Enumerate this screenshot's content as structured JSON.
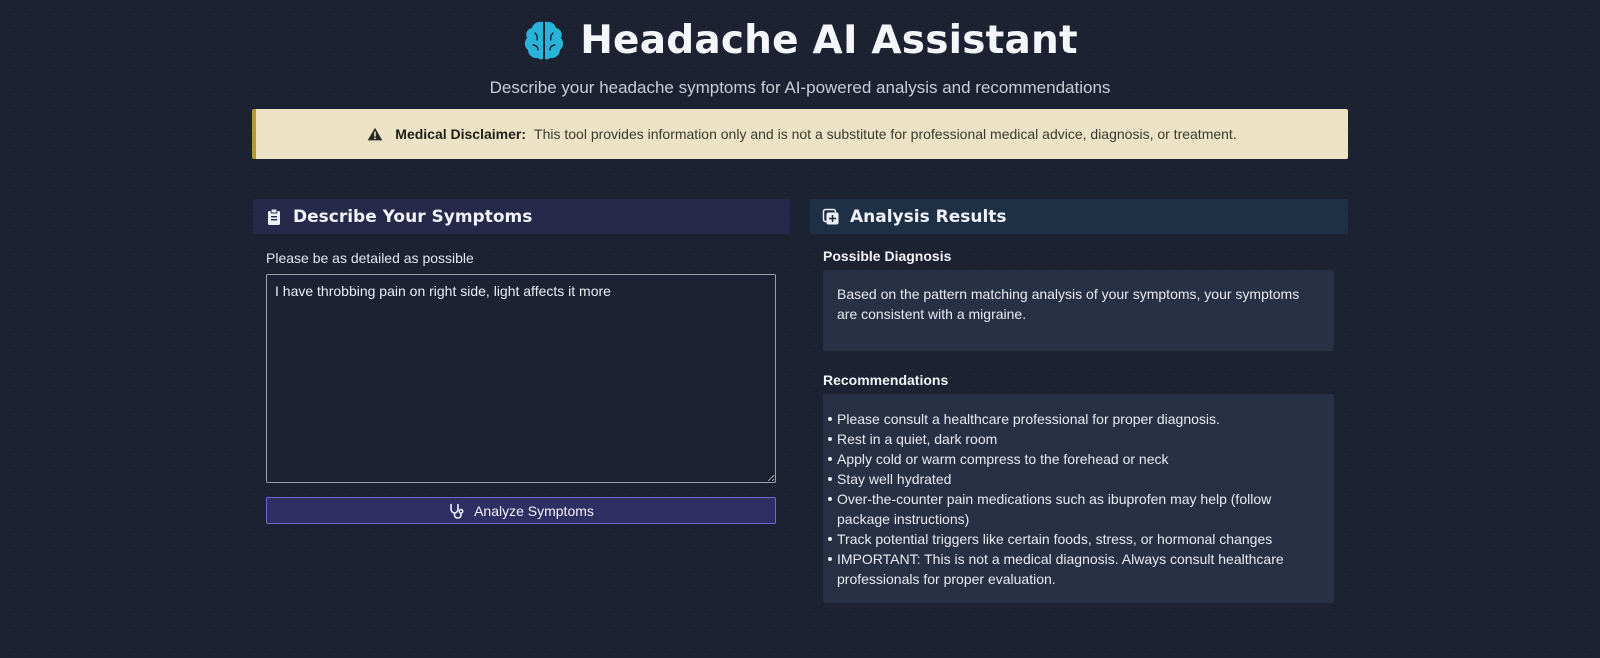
{
  "header": {
    "title": "Headache AI Assistant",
    "subtitle": "Describe your headache symptoms for AI-powered analysis and recommendations",
    "icon": "brain-icon"
  },
  "disclaimer": {
    "icon": "warning-icon",
    "label": "Medical Disclaimer:",
    "text": "This tool provides information only and is not a substitute for professional medical advice, diagnosis, or treatment."
  },
  "symptoms_panel": {
    "icon": "clipboard-icon",
    "title": "Describe Your Symptoms",
    "field_label": "Please be as detailed as possible",
    "textarea_value": "I have throbbing pain on right side, light affects it more",
    "button_icon": "stethoscope-icon",
    "button_label": "Analyze Symptoms"
  },
  "results_panel": {
    "icon": "medical-kit-icon",
    "title": "Analysis Results",
    "diagnosis_title": "Possible Diagnosis",
    "diagnosis_text": "Based on the pattern matching analysis of your symptoms, your symptoms are consistent with a migraine.",
    "recommendations_title": "Recommendations",
    "recommendations": [
      "Please consult a healthcare professional for proper diagnosis.",
      "Rest in a quiet, dark room",
      "Apply cold or warm compress to the forehead or neck",
      "Stay well hydrated",
      "Over-the-counter pain medications such as ibuprofen may help (follow package instructions)",
      "Track potential triggers like certain foods, stress, or hormonal changes",
      "IMPORTANT: This is not a medical diagnosis. Always consult healthcare professionals for proper evaluation."
    ]
  },
  "colors": {
    "background": "#1c2231",
    "accent_brain": "#29b3d9",
    "disclaimer_bg": "#ece3c7",
    "button_bg": "#302f63",
    "button_border": "#6b69c7"
  }
}
